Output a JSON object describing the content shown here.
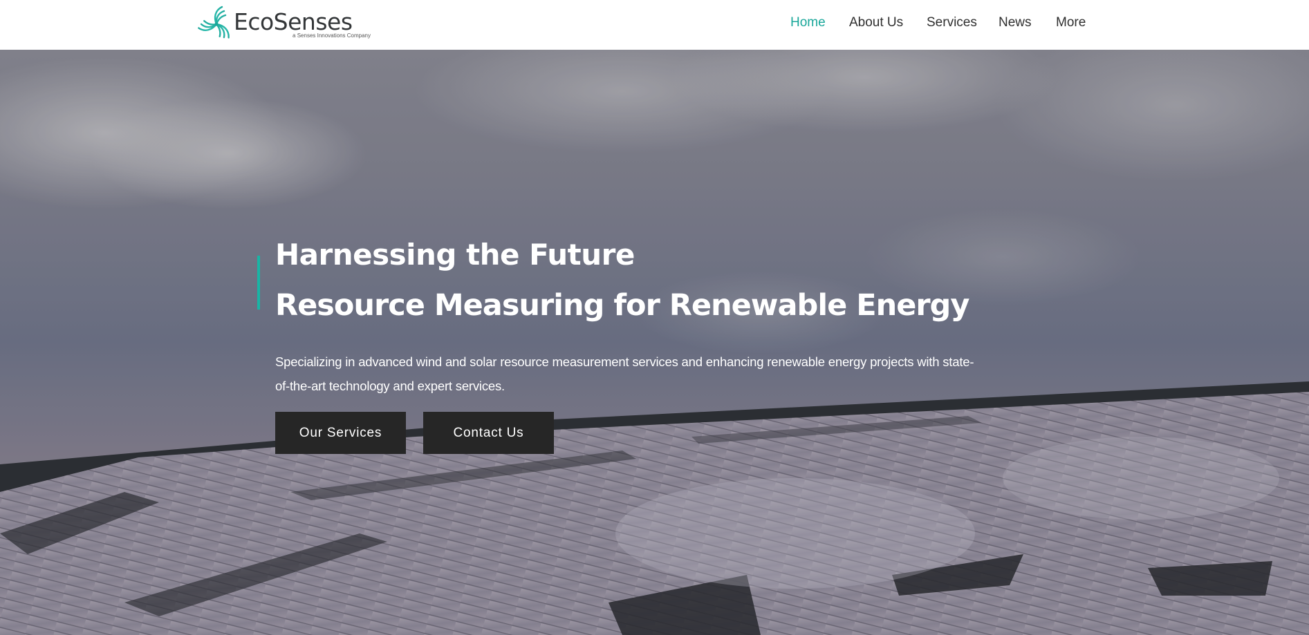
{
  "header": {
    "logo": {
      "wordmark": "EcoSenses",
      "tagline": "a Senses Innovations Company",
      "icon": "triskelion-turbine-icon",
      "accent_color": "#1aa79a"
    },
    "nav": [
      {
        "label": "Home",
        "active": true
      },
      {
        "label": "About Us",
        "active": false
      },
      {
        "label": "Services",
        "active": false
      },
      {
        "label": "News",
        "active": false
      },
      {
        "label": "More",
        "active": false
      }
    ]
  },
  "hero": {
    "background": "solar-panel-field-photo",
    "headline": "Harnessing the Future",
    "subheadline": "Resource Measuring for Renewable Energy",
    "description": "Specializing in advanced wind and solar resource measurement services and enhancing renewable energy projects with state-of-the-art technology and expert services.",
    "buttons": {
      "services": "Our Services",
      "contact": "Contact Us"
    },
    "accent_color": "#18b5a5",
    "button_color": "#262626"
  }
}
